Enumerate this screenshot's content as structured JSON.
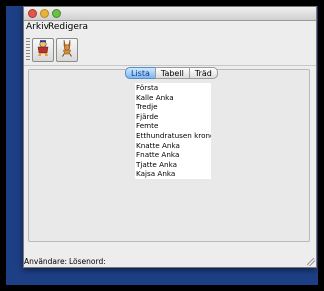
{
  "menubar": {
    "items": [
      {
        "label": "Arkiv"
      },
      {
        "label": "Redigera"
      }
    ]
  },
  "toolbar": {
    "buttons": [
      {
        "icon": "duck-icon"
      },
      {
        "icon": "bunny-icon"
      }
    ]
  },
  "tabs": [
    {
      "label": "Lista",
      "active": true
    },
    {
      "label": "Tabell",
      "active": false
    },
    {
      "label": "Träd",
      "active": false
    }
  ],
  "list": {
    "items": [
      "Första",
      "Kalle Anka",
      "Tredje",
      "Fjärde",
      "Femte",
      "Etthundratusen kronor",
      "Knatte Anka",
      "Fnatte Anka",
      "Tjatte Anka",
      "Kajsa Anka"
    ]
  },
  "statusbar": {
    "user_label": "Användare:",
    "password_label": "Lösenord:"
  },
  "colors": {
    "desktop": "#1d3f86",
    "close": "#e0574f",
    "minimize": "#e5b53b",
    "maximize": "#6cc04a",
    "active_tab": "#7fb8f1"
  }
}
